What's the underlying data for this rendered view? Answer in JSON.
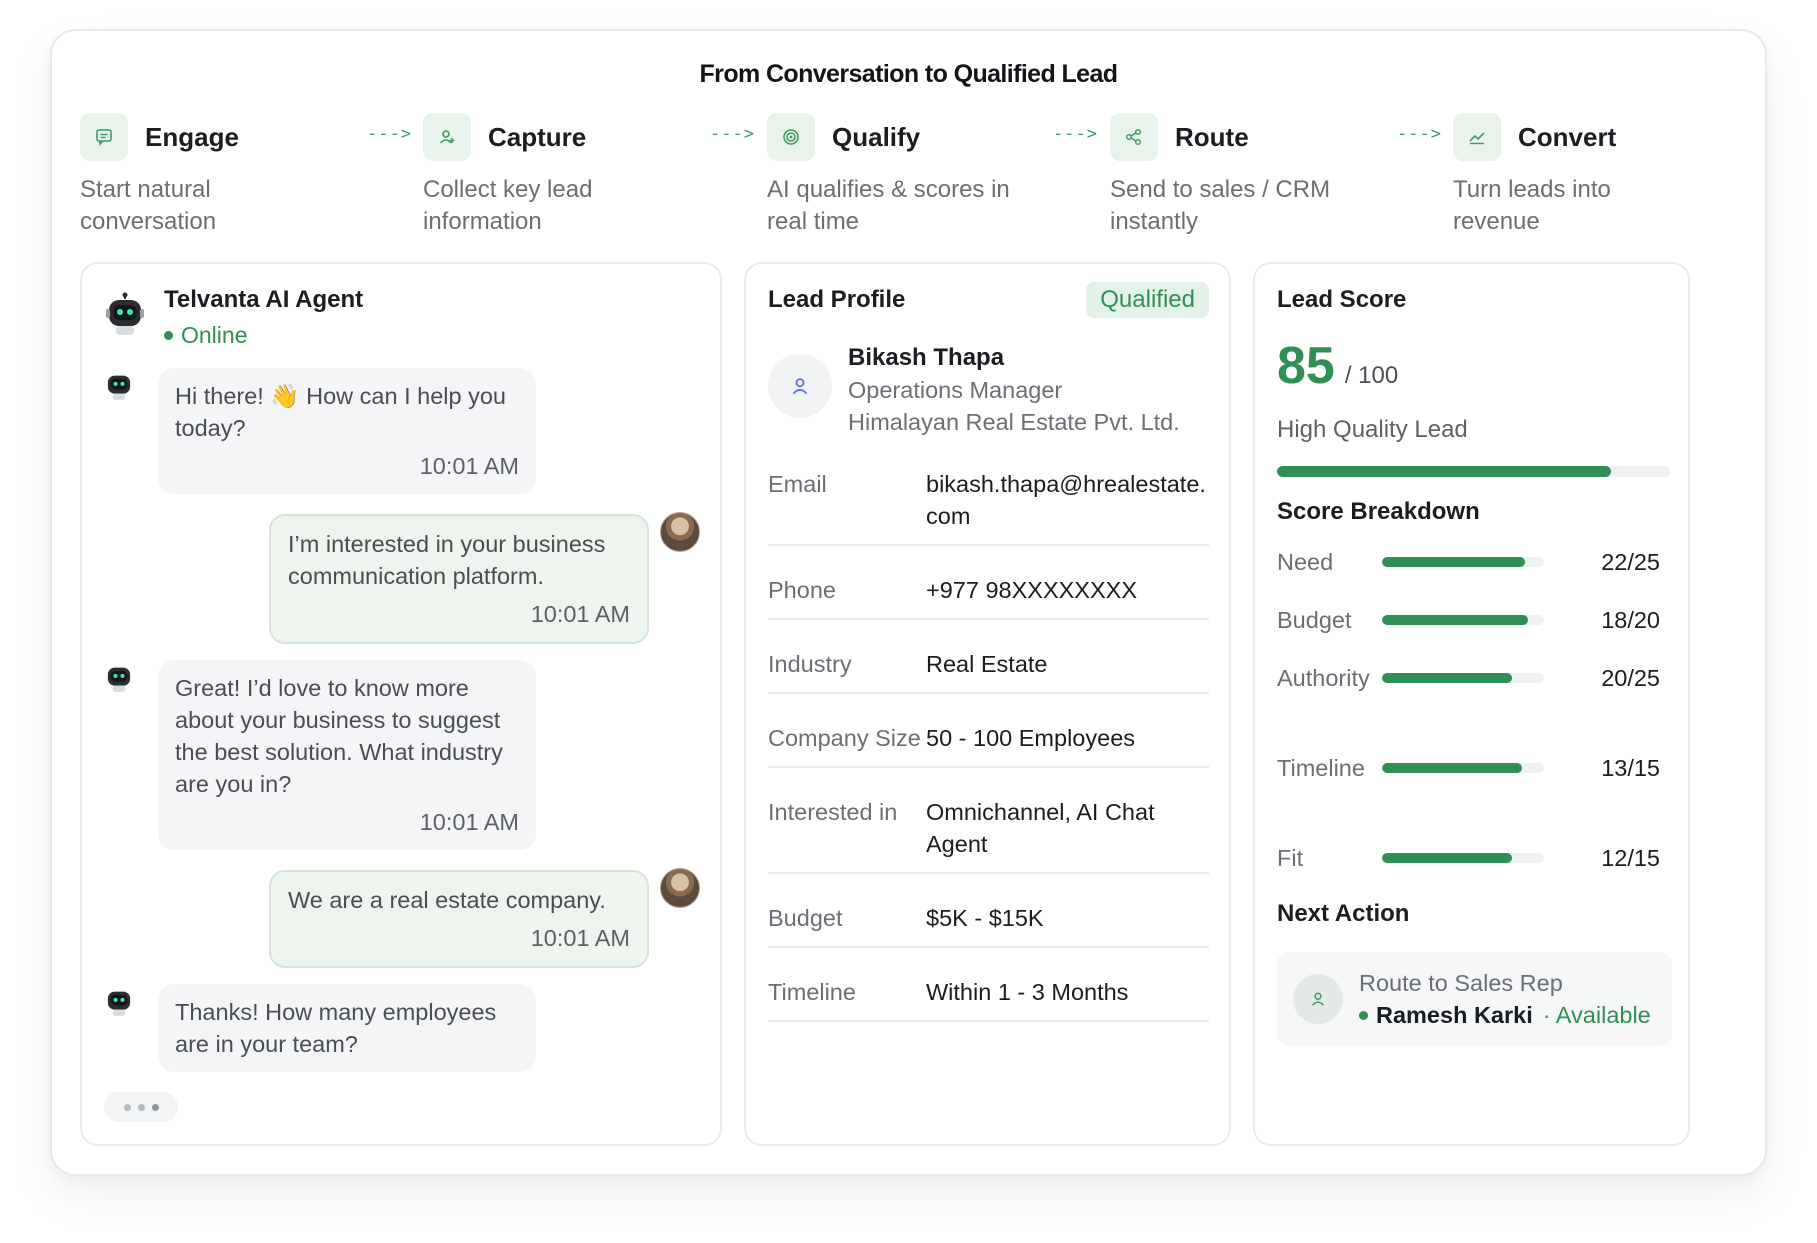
{
  "title": "From Conversation to Qualified Lead",
  "steps": [
    {
      "name": "Engage",
      "desc": "Start natural conversation",
      "icon": "chat-icon"
    },
    {
      "name": "Capture",
      "desc": "Collect key lead information",
      "icon": "user-plus-icon"
    },
    {
      "name": "Qualify",
      "desc": "AI qualifies & scores in real time",
      "icon": "target-icon"
    },
    {
      "name": "Route",
      "desc": "Send to sales / CRM instantly",
      "icon": "share-icon"
    },
    {
      "name": "Convert",
      "desc": "Turn leads into revenue",
      "icon": "trend-icon"
    }
  ],
  "arrow": "--->",
  "chat": {
    "agent_name": "Telvanta AI Agent",
    "status": "Online",
    "messages": [
      {
        "from": "bot",
        "text": "Hi there! 👋 How can I help you today?",
        "time": "10:01 AM"
      },
      {
        "from": "user",
        "text": "I’m interested in your business communication platform.",
        "time": "10:01 AM"
      },
      {
        "from": "bot",
        "text": "Great! I’d love to know more about your business to suggest the best solution. What industry are you in?",
        "time": "10:01 AM"
      },
      {
        "from": "user",
        "text": "We are a real estate company.",
        "time": "10:01 AM"
      },
      {
        "from": "bot",
        "text": "Thanks! How many employees are in your team?",
        "time": ""
      }
    ]
  },
  "profile": {
    "title": "Lead Profile",
    "badge": "Qualified",
    "name": "Bikash Thapa",
    "role": "Operations Manager",
    "company": "Himalayan Real Estate Pvt. Ltd.",
    "rows": [
      {
        "k": "Email",
        "v": "bikash.thapa@hrealestate.com"
      },
      {
        "k": "Phone",
        "v": "+977 98XXXXXXXX"
      },
      {
        "k": "Industry",
        "v": "Real Estate"
      },
      {
        "k": "Company Size",
        "v": "50 - 100 Employees"
      },
      {
        "k": "Interested in",
        "v": "Omnichannel, AI Chat Agent"
      },
      {
        "k": "Budget",
        "v": "$5K - $15K"
      },
      {
        "k": "Timeline",
        "v": "Within 1 - 3 Months"
      }
    ]
  },
  "score": {
    "title": "Lead Score",
    "value": "85",
    "max": "/ 100",
    "fraction": 0.85,
    "label": "High Quality Lead",
    "breakdown_title": "Score Breakdown",
    "breakdown": [
      {
        "name": "Need",
        "value": "22/25",
        "fraction": 0.88
      },
      {
        "name": "Budget",
        "value": "18/20",
        "fraction": 0.9
      },
      {
        "name": "Authority",
        "value": "20/25",
        "fraction": 0.8
      },
      {
        "name": "Timeline",
        "value": "13/15",
        "fraction": 0.867
      },
      {
        "name": "Fit",
        "value": "12/15",
        "fraction": 0.8
      }
    ],
    "next_title": "Next Action",
    "next_line1": "Route to Sales Rep",
    "next_rep": "Ramesh Karki",
    "next_status": "· Available"
  },
  "colors": {
    "accent": "#2f8f55",
    "accent_light": "#e8f3ec"
  }
}
